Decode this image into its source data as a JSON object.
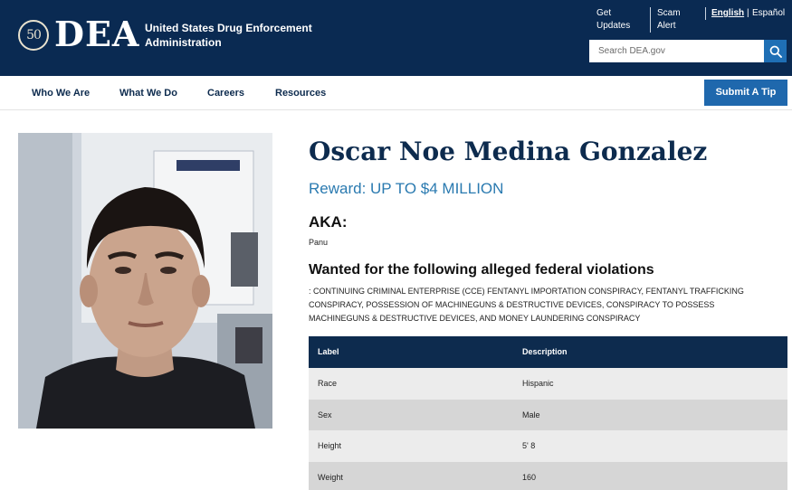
{
  "header": {
    "seal_text": "50",
    "logo_text": "DEA",
    "agency_line1": "United States Drug Enforcement",
    "agency_line2": "Administration",
    "utility": {
      "get_updates_1": "Get",
      "get_updates_2": "Updates",
      "scam_alert_1": "Scam",
      "scam_alert_2": "Alert",
      "english": "English",
      "divider": "|",
      "espanol": "Español"
    },
    "search_placeholder": "Search DEA.gov"
  },
  "nav": {
    "items": [
      "Who We Are",
      "What We Do",
      "Careers",
      "Resources"
    ],
    "tip_button": "Submit A Tip"
  },
  "profile": {
    "name": "Oscar Noe Medina Gonzalez",
    "reward": "Reward: UP TO $4 MILLION",
    "aka_heading": "AKA:",
    "aka_value": "Panu",
    "violations_heading": "Wanted for the following alleged federal violations",
    "violations_line1": ": CONTINUING CRIMINAL ENTERPRISE (CCE) FENTANYL IMPORTATION CONSPIRACY, FENTANYL TRAFFICKING",
    "violations_line2": "CONSPIRACY, POSSESSION OF MACHINEGUNS & DESTRUCTIVE DEVICES, CONSPIRACY TO POSSESS",
    "violations_line3": "MACHINEGUNS & DESTRUCTIVE DEVICES, AND MONEY LAUNDERING CONSPIRACY"
  },
  "table": {
    "headers": [
      "Label",
      "Description"
    ],
    "rows": [
      {
        "label": "Race",
        "description": "Hispanic"
      },
      {
        "label": "Sex",
        "description": "Male"
      },
      {
        "label": "Height",
        "description": "5' 8"
      },
      {
        "label": "Weight",
        "description": "160"
      }
    ]
  },
  "colors": {
    "header_bg": "#0a2a52",
    "accent_blue": "#1f68ad",
    "reward_text": "#2a7ab0",
    "table_header": "#0d2b4e"
  },
  "icons": {
    "search": "search-icon",
    "seal": "seal-icon"
  }
}
